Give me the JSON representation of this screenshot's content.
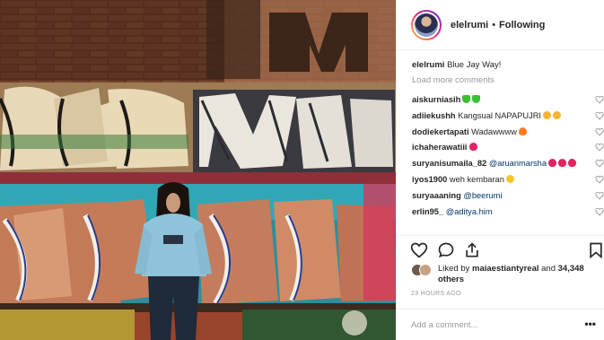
{
  "post": {
    "username": "elelrumi",
    "separator": "•",
    "follow_status": "Following",
    "caption_user": "elelrumi",
    "caption_text": "Blue Jay Way!",
    "load_more": "Load more comments"
  },
  "comments": [
    {
      "user": "aiskurniasih",
      "text": "",
      "mention": "",
      "emoji": [
        "green",
        "green"
      ]
    },
    {
      "user": "adiiekushh",
      "text": "Kangsual NAPAPUJRI",
      "mention": "",
      "emoji": [
        "hands",
        "hands"
      ]
    },
    {
      "user": "dodiekertapati",
      "text": "Wadawwww",
      "mention": "",
      "emoji": [
        "fire"
      ]
    },
    {
      "user": "ichaherawatiii",
      "text": "",
      "mention": "",
      "emoji": [
        "red"
      ]
    },
    {
      "user": "suryanisumaila_82",
      "text": "",
      "mention": "@aruanmarsha",
      "emoji": [
        "red",
        "red",
        "red"
      ]
    },
    {
      "user": "iyos1900",
      "text": "weh kembaran",
      "mention": "",
      "emoji": [
        "face"
      ]
    },
    {
      "user": "suryaaaning",
      "text": "",
      "mention": "@beerumi",
      "emoji": []
    },
    {
      "user": "erlin95_",
      "text": "",
      "mention": "@aditya.him",
      "emoji": []
    }
  ],
  "actions": {
    "like_icon": "heart-icon",
    "comment_icon": "comment-icon",
    "share_icon": "share-icon",
    "save_icon": "bookmark-icon"
  },
  "likes": {
    "prefix": "Liked by",
    "user": "maiaestiantyreal",
    "conj": "and",
    "count": "34,348",
    "suffix": "others"
  },
  "timestamp": "23 HOURS AGO",
  "add_comment": {
    "placeholder": "Add a comment...",
    "more": "•••"
  },
  "colors": {
    "text": "#262626",
    "muted": "#999999",
    "mention": "#003569",
    "border": "#efefef"
  }
}
